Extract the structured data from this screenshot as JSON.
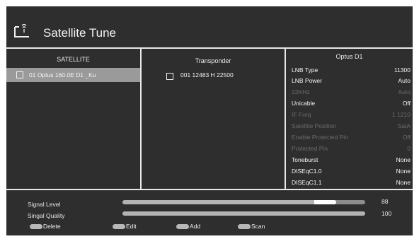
{
  "header": {
    "title": "Satellite Tune",
    "icon": "satellite-dish-icon"
  },
  "columns": {
    "satellite": "SATELLITE",
    "transponder": "Transponder",
    "satellite_detail": "Optus D1"
  },
  "satellite_list": [
    {
      "label": "01 Optus 160.0E D1 _Ku",
      "selected": true
    }
  ],
  "transponder_list": [
    {
      "label": "001  12483 H 22500"
    }
  ],
  "parameters": [
    {
      "label": "LNB Type",
      "value": "11300",
      "enabled": true
    },
    {
      "label": "LNB Power",
      "value": "Auto",
      "enabled": true
    },
    {
      "label": "22KHz",
      "value": "Auto",
      "enabled": false
    },
    {
      "label": "Unicable",
      "value": "Off",
      "enabled": true
    },
    {
      "label": "IF Freq",
      "value": "1 1210",
      "enabled": false
    },
    {
      "label": "Satellite Position",
      "value": "SatA",
      "enabled": false
    },
    {
      "label": "Enable Protected Pin",
      "value": "Off",
      "enabled": false
    },
    {
      "label": "Protected Pin",
      "value": "0",
      "enabled": false
    },
    {
      "label": "Toneburst",
      "value": "None",
      "enabled": true
    },
    {
      "label": "DISEqC1.0",
      "value": "None",
      "enabled": true
    },
    {
      "label": "DISEqC1.1",
      "value": "None",
      "enabled": true
    }
  ],
  "meters": [
    {
      "label": "Signal Level",
      "value": "88",
      "percent": 88
    },
    {
      "label": "Singal Quality",
      "value": "100",
      "percent": 100
    }
  ],
  "keys": [
    {
      "label": "Delete"
    },
    {
      "label": "Edit"
    },
    {
      "label": "Add"
    },
    {
      "label": "Scan"
    }
  ],
  "colors": {
    "panel_bg": "#2e2e2e",
    "selected_row": "#9a9a9a",
    "disabled_text": "#6b6b6b",
    "divider": "#e9e9e9"
  }
}
